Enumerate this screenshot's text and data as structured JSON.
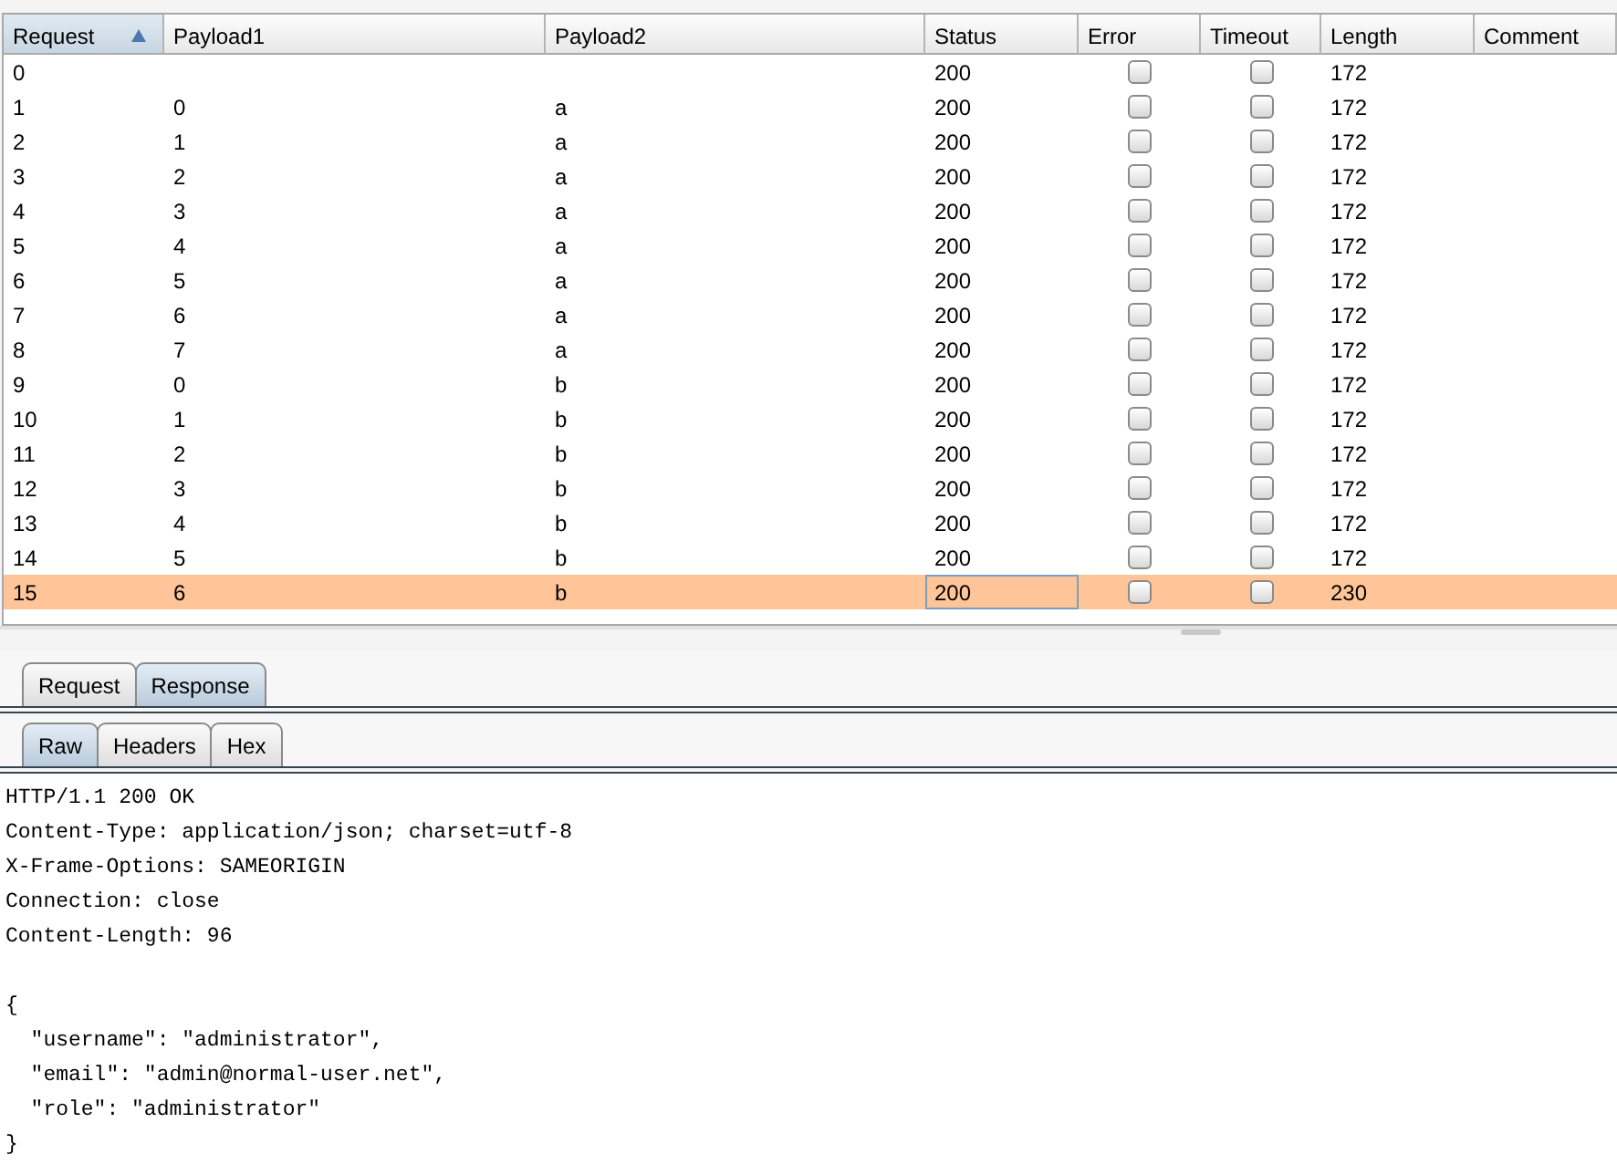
{
  "table": {
    "columns": [
      {
        "label": "Request",
        "sorted": true
      },
      {
        "label": "Payload1",
        "sorted": false
      },
      {
        "label": "Payload2",
        "sorted": false
      },
      {
        "label": "Status",
        "sorted": false
      },
      {
        "label": "Error",
        "sorted": false
      },
      {
        "label": "Timeout",
        "sorted": false
      },
      {
        "label": "Length",
        "sorted": false
      },
      {
        "label": "Comment",
        "sorted": false
      }
    ],
    "rows": [
      {
        "request": "0",
        "payload1": "",
        "payload2": "",
        "status": "200",
        "error": false,
        "timeout": false,
        "length": "172",
        "selected": false
      },
      {
        "request": "1",
        "payload1": "0",
        "payload2": "a",
        "status": "200",
        "error": false,
        "timeout": false,
        "length": "172",
        "selected": false
      },
      {
        "request": "2",
        "payload1": "1",
        "payload2": "a",
        "status": "200",
        "error": false,
        "timeout": false,
        "length": "172",
        "selected": false
      },
      {
        "request": "3",
        "payload1": "2",
        "payload2": "a",
        "status": "200",
        "error": false,
        "timeout": false,
        "length": "172",
        "selected": false
      },
      {
        "request": "4",
        "payload1": "3",
        "payload2": "a",
        "status": "200",
        "error": false,
        "timeout": false,
        "length": "172",
        "selected": false
      },
      {
        "request": "5",
        "payload1": "4",
        "payload2": "a",
        "status": "200",
        "error": false,
        "timeout": false,
        "length": "172",
        "selected": false
      },
      {
        "request": "6",
        "payload1": "5",
        "payload2": "a",
        "status": "200",
        "error": false,
        "timeout": false,
        "length": "172",
        "selected": false
      },
      {
        "request": "7",
        "payload1": "6",
        "payload2": "a",
        "status": "200",
        "error": false,
        "timeout": false,
        "length": "172",
        "selected": false
      },
      {
        "request": "8",
        "payload1": "7",
        "payload2": "a",
        "status": "200",
        "error": false,
        "timeout": false,
        "length": "172",
        "selected": false
      },
      {
        "request": "9",
        "payload1": "0",
        "payload2": "b",
        "status": "200",
        "error": false,
        "timeout": false,
        "length": "172",
        "selected": false
      },
      {
        "request": "10",
        "payload1": "1",
        "payload2": "b",
        "status": "200",
        "error": false,
        "timeout": false,
        "length": "172",
        "selected": false
      },
      {
        "request": "11",
        "payload1": "2",
        "payload2": "b",
        "status": "200",
        "error": false,
        "timeout": false,
        "length": "172",
        "selected": false
      },
      {
        "request": "12",
        "payload1": "3",
        "payload2": "b",
        "status": "200",
        "error": false,
        "timeout": false,
        "length": "172",
        "selected": false
      },
      {
        "request": "13",
        "payload1": "4",
        "payload2": "b",
        "status": "200",
        "error": false,
        "timeout": false,
        "length": "172",
        "selected": false
      },
      {
        "request": "14",
        "payload1": "5",
        "payload2": "b",
        "status": "200",
        "error": false,
        "timeout": false,
        "length": "172",
        "selected": false
      },
      {
        "request": "15",
        "payload1": "6",
        "payload2": "b",
        "status": "200",
        "error": false,
        "timeout": false,
        "length": "230",
        "selected": true
      }
    ]
  },
  "tabs": [
    {
      "label": "Request",
      "selected": false
    },
    {
      "label": "Response",
      "selected": true
    }
  ],
  "subtabs": [
    {
      "label": "Raw",
      "selected": true
    },
    {
      "label": "Headers",
      "selected": false
    },
    {
      "label": "Hex",
      "selected": false
    }
  ],
  "response": {
    "headers": [
      "HTTP/1.1 200 OK",
      "Content-Type: application/json; charset=utf-8",
      "X-Frame-Options: SAMEORIGIN",
      "Connection: close",
      "Content-Length: 96"
    ],
    "body": [
      "{",
      "  \"username\": \"administrator\",",
      "  \"email\": \"admin@normal-user.net\",",
      "  \"role\": \"administrator\"",
      "}"
    ]
  }
}
